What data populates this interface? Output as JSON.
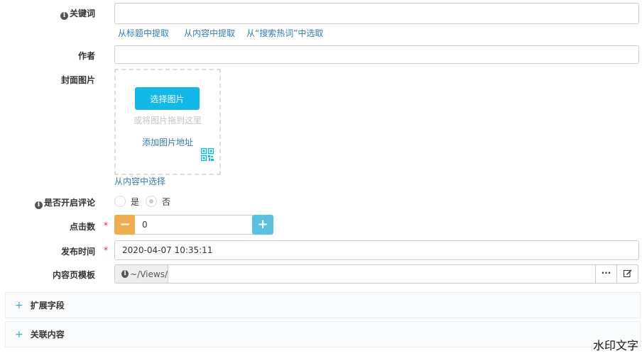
{
  "keyword": {
    "label": "关键词",
    "value": "",
    "links": [
      "从标题中提取",
      "从内容中提取",
      "从“搜索热词”中选取"
    ]
  },
  "author": {
    "label": "作者",
    "value": ""
  },
  "cover": {
    "label": "封面图片",
    "choose_button": "选择图片",
    "drag_hint": "或将图片拖到这里",
    "add_url_link": "添加图片地址",
    "from_content_link": "从内容中选择"
  },
  "comments": {
    "label": "是否开启评论",
    "options": [
      "是",
      "否"
    ],
    "selected": "否"
  },
  "clicks": {
    "label": "点击数",
    "required_mark": "*",
    "value": "0",
    "minus": "−",
    "plus": "+"
  },
  "publish_time": {
    "label": "发布时间",
    "required_mark": "*",
    "value": "2020-04-07 10:35:11"
  },
  "template": {
    "label": "内容页模板",
    "prefix": "~/Views/",
    "value": ""
  },
  "panels": [
    {
      "expand_icon": "+",
      "title": "扩展字段"
    },
    {
      "expand_icon": "+",
      "title": "关联内容"
    }
  ],
  "watermark": "水印文字",
  "colors": {
    "primary": "#12b8e8",
    "minus_button": "#f0ad4e",
    "plus_button": "#5bc0de",
    "link": "#337ab7",
    "required": "#ee2233"
  }
}
